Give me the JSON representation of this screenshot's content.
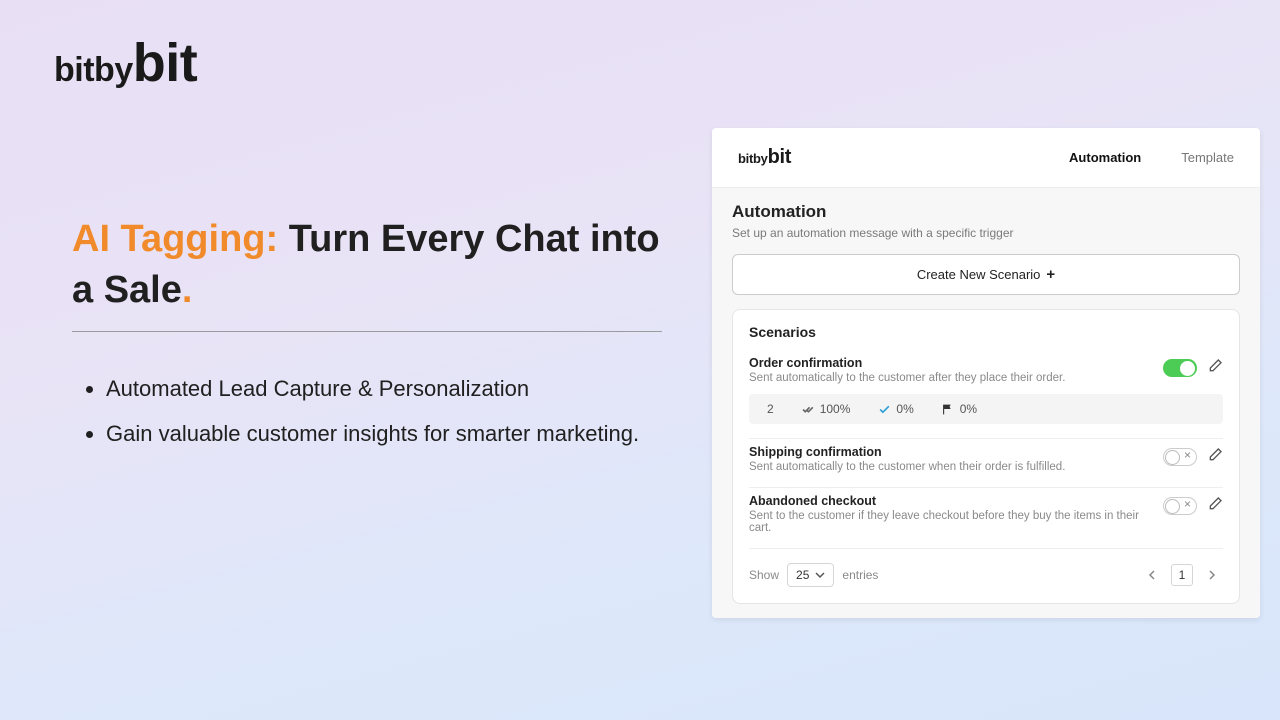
{
  "logo": {
    "part1": "bit",
    "part2": "by",
    "part3": "bit"
  },
  "headline": {
    "accent": "AI Tagging:",
    "rest": " Turn Every Chat into a Sale",
    "period": "."
  },
  "bullets": [
    "Automated Lead Capture & Personalization",
    "Gain valuable customer insights for smarter marketing."
  ],
  "panel": {
    "logo": {
      "part1": "bit",
      "part2": "by",
      "part3": "bit"
    },
    "nav": {
      "automation": "Automation",
      "template": "Template"
    },
    "title": "Automation",
    "subtitle": "Set up an automation message with a specific trigger",
    "create_label": "Create New Scenario",
    "card_title": "Scenarios",
    "scenarios": [
      {
        "title": "Order confirmation",
        "desc": "Sent automatically to the customer after they place their order.",
        "enabled": true,
        "metrics": {
          "count": "2",
          "delivered": "100%",
          "opened": "0%",
          "replied": "0%"
        }
      },
      {
        "title": "Shipping confirmation",
        "desc": "Sent automatically to the customer when their order is fulfilled.",
        "enabled": false
      },
      {
        "title": "Abandoned checkout",
        "desc": "Sent to the customer if they leave checkout before they buy the items in their cart.",
        "enabled": false
      }
    ],
    "pager": {
      "show": "Show",
      "page_size": "25",
      "entries": "entries",
      "current": "1"
    }
  }
}
